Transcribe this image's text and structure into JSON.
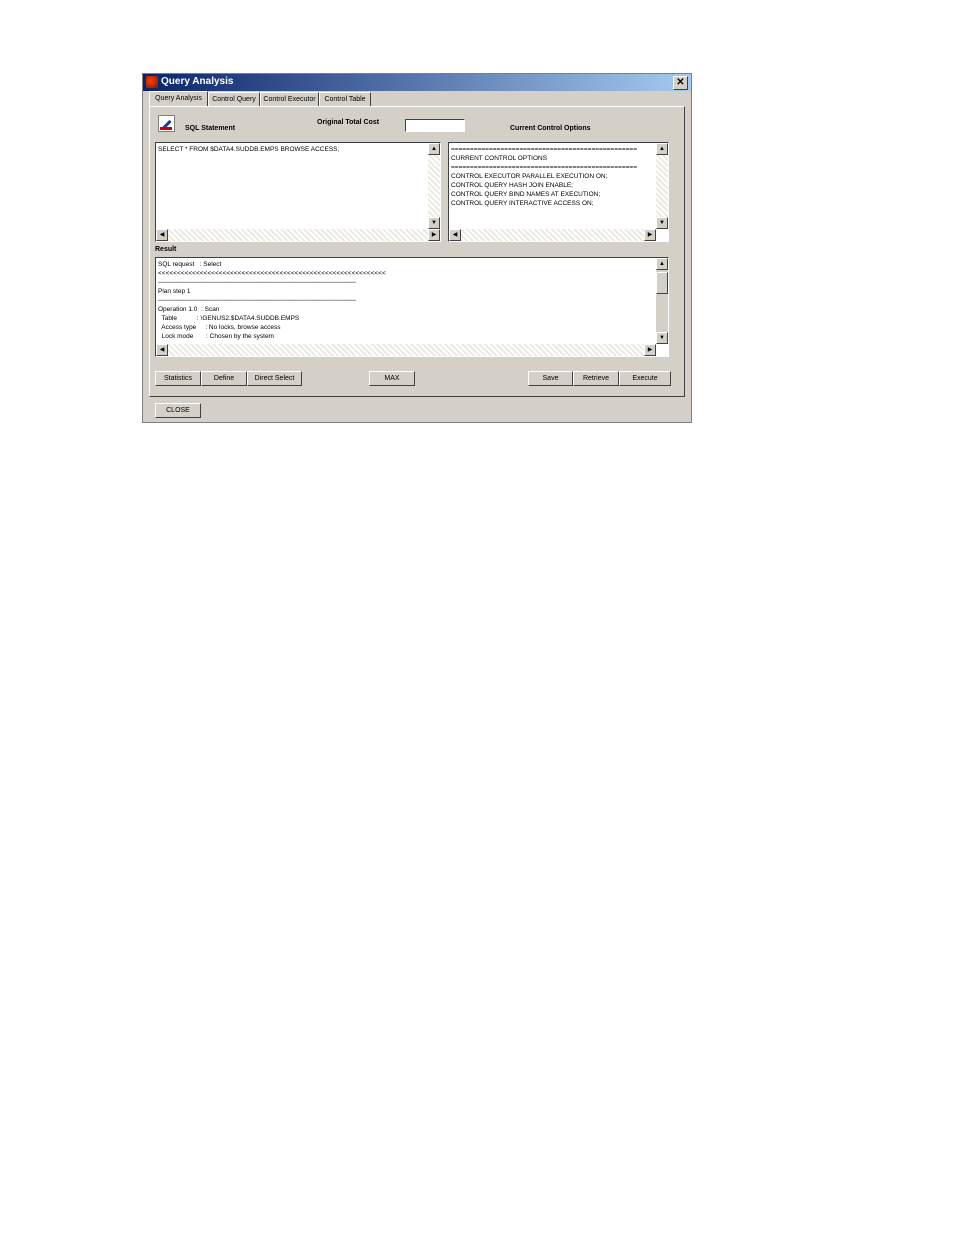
{
  "window": {
    "title": "Query Analysis",
    "close_label": "✕"
  },
  "tabs": [
    {
      "label": "Query Analysis"
    },
    {
      "label": "Control Query"
    },
    {
      "label": "Control Executor"
    },
    {
      "label": "Control Table"
    }
  ],
  "labels": {
    "sql_statement": "SQL Statement",
    "original_total_cost": "Original Total Cost",
    "current_control_options": "Current Control Options",
    "result": "Result"
  },
  "original_total_cost_value": "",
  "sql_text": "SELECT * FROM $DATA4.SUDDB.EMPS BROWSE ACCESS;",
  "control_options_lines": [
    "=================================================",
    "CURRENT CONTROL OPTIONS",
    "=================================================",
    "CONTROL EXECUTOR PARALLEL EXECUTION ON;",
    "CONTROL QUERY HASH JOIN ENABLE;",
    "CONTROL QUERY BIND NAMES AT EXECUTION;",
    "CONTROL QUERY INTERACTIVE ACCESS ON;"
  ],
  "result_lines": [
    "SQL request   : Select",
    "<<<<<<<<<<<<<<<<<<<<<<<<<<<<<<<<<<<<<<<<<<<<<<<<<<<<<<<<<<<<",
    "───────────────────────────────────────────",
    "Plan step 1",
    "───────────────────────────────────────────",
    "Operation 1.0  : Scan",
    "  Table           : \\GENUS2.$DATA4.SUDDB.EMPS",
    "  Access type     : No locks, browse access",
    "  Lock mode       : Chosen by the system"
  ],
  "buttons": {
    "statistics": "Statistics",
    "define": "Define",
    "direct_select": "Direct Select",
    "max": "MAX",
    "save": "Save",
    "retrieve": "Retrieve",
    "execute": "Execute",
    "close": "CLOSE"
  },
  "colors": {
    "face": "#d4d0c8",
    "title_start": "#0a246a",
    "title_end": "#a6caf0"
  }
}
